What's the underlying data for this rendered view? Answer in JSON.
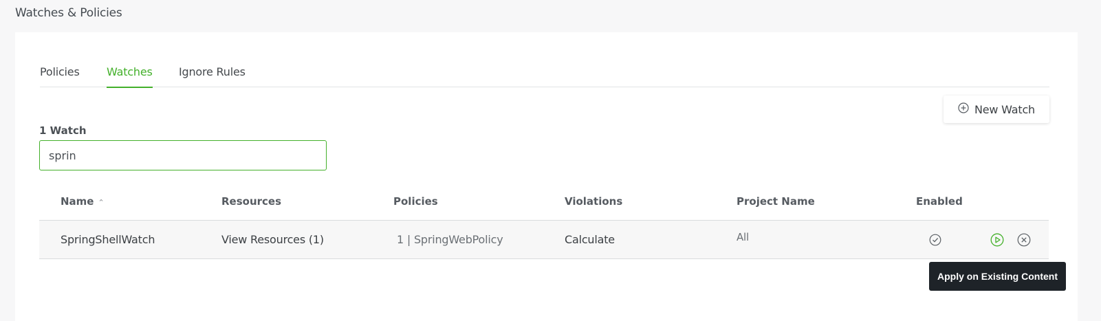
{
  "page_title": "Watches & Policies",
  "tabs": [
    {
      "label": "Policies",
      "active": false
    },
    {
      "label": "Watches",
      "active": true
    },
    {
      "label": "Ignore Rules",
      "active": false
    }
  ],
  "toolbar": {
    "new_watch_label": "New Watch",
    "new_watch_icon": "plus-circle-icon"
  },
  "watch_count_label": "1 Watch",
  "search": {
    "value": "sprin",
    "placeholder": ""
  },
  "table": {
    "columns": [
      "Name",
      "Resources",
      "Policies",
      "Violations",
      "Project Name",
      "Enabled"
    ],
    "sorted_column": "Name",
    "sort_direction": "ascending",
    "rows": [
      {
        "name": "SpringShellWatch",
        "resources": "View Resources (1)",
        "policies": "1 | SpringWebPolicy",
        "violations": "Calculate",
        "project_name": "All",
        "enabled_icon": "check-circle-icon",
        "actions": [
          "play-circle-icon",
          "close-circle-icon"
        ]
      }
    ]
  },
  "tooltip": "Apply on Existing Content",
  "colors": {
    "accent": "#43b02a",
    "tooltip_bg": "#1e2328",
    "row_bg": "#f7f7f7"
  }
}
